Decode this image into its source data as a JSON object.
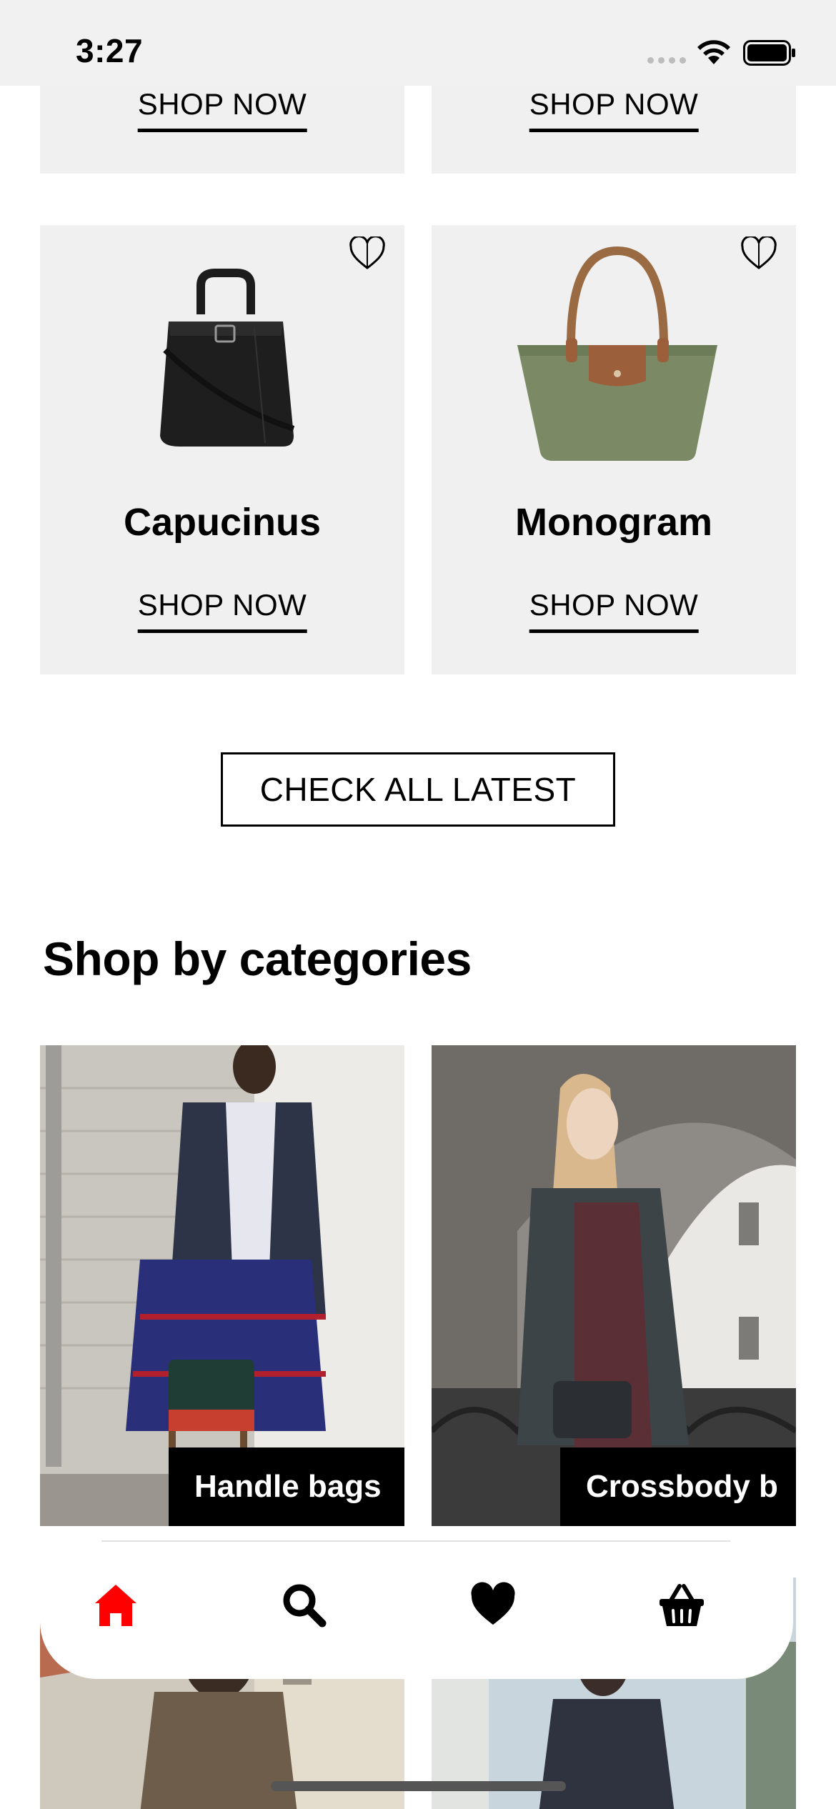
{
  "status_bar": {
    "time": "3:27"
  },
  "featured": {
    "top_row": [
      {
        "cta": "SHOP NOW"
      },
      {
        "cta": "SHOP NOW"
      }
    ],
    "products": [
      {
        "name": "Capucinus",
        "cta": "SHOP NOW",
        "color": "#1c1c1c"
      },
      {
        "name": "Monogram",
        "cta": "SHOP NOW",
        "color": "#7b8a65"
      }
    ],
    "check_all_label": "CHECK ALL LATEST"
  },
  "categories": {
    "title": "Shop by categories",
    "items": [
      {
        "label": "Handle bags"
      },
      {
        "label": "Crossbody b"
      },
      {
        "label": ""
      },
      {
        "label": ""
      }
    ]
  },
  "tab_bar": {
    "active_color": "#ff0000",
    "tabs": [
      {
        "icon": "home-icon",
        "active": true
      },
      {
        "icon": "search-icon",
        "active": false
      },
      {
        "icon": "heart-icon",
        "active": false
      },
      {
        "icon": "basket-icon",
        "active": false
      }
    ]
  }
}
